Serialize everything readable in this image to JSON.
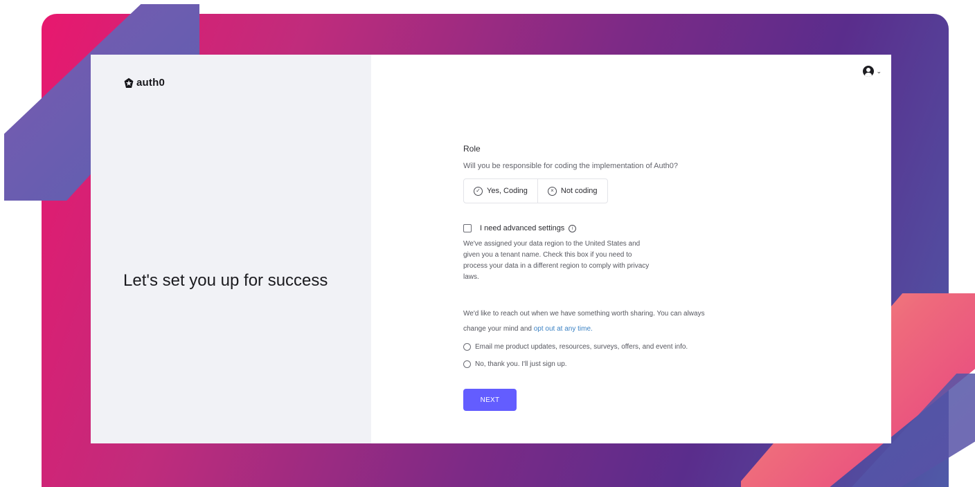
{
  "brand": {
    "name": "auth0"
  },
  "tagline": "Let's set you up for success",
  "role": {
    "label": "Role",
    "question": "Will you be responsible for coding the implementation of Auth0?",
    "options": [
      "Yes, Coding",
      "Not coding"
    ]
  },
  "advanced": {
    "label": "I need advanced settings",
    "description": "We've assigned your data region to the United States and given you a tenant name. Check this box if you need to process your data in a different region to comply with privacy laws."
  },
  "marketing": {
    "text": "We'd like to reach out when we have something worth sharing. You can always change your mind and",
    "link": "opt out at any time.",
    "options": [
      "Email me product updates, resources, surveys, offers, and event info.",
      "No, thank you. I'll just sign up."
    ]
  },
  "next_label": "NEXT",
  "icons": {
    "user": "user-avatar-icon",
    "chevron": "chevron-down-icon",
    "check": "check-circle-icon",
    "close": "x-circle-icon",
    "info": "info-icon"
  }
}
